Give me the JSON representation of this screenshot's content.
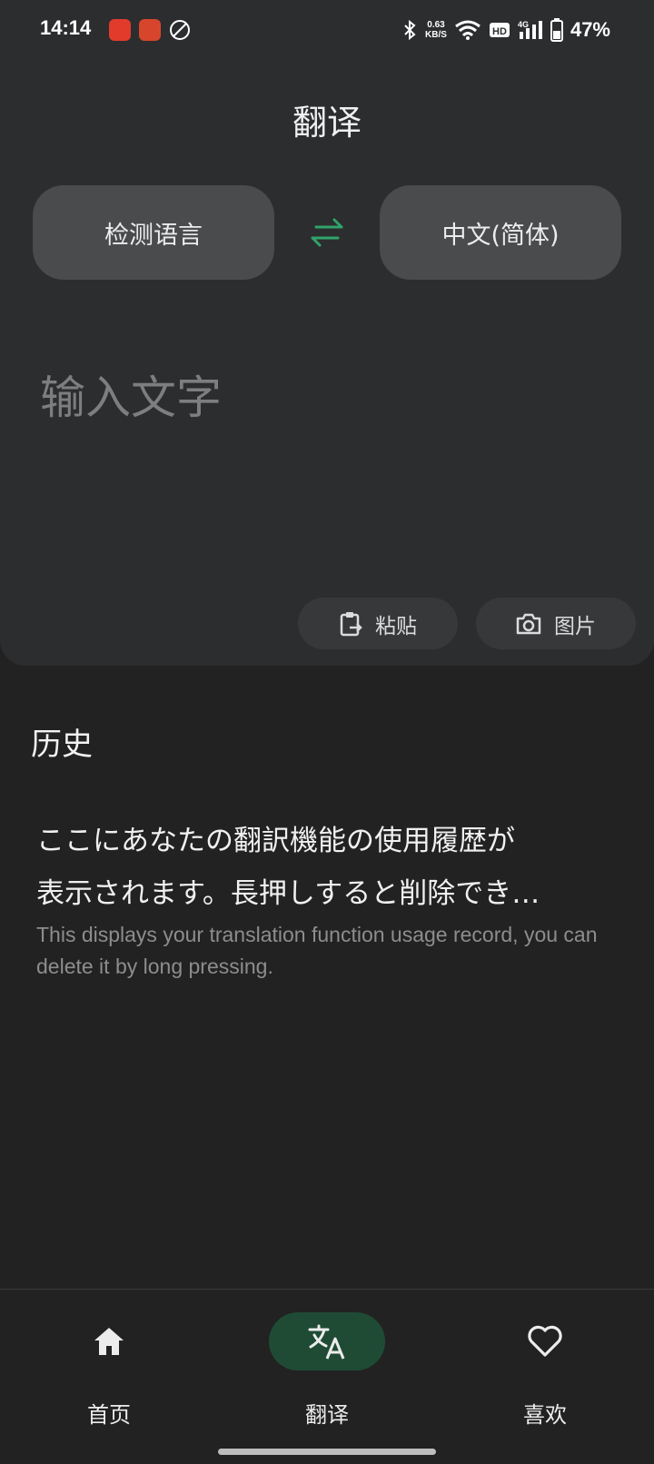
{
  "status_bar": {
    "time": "14:14",
    "net_speed_value": "0.63",
    "net_speed_unit": "KB/S",
    "battery": "47%"
  },
  "header": {
    "title": "翻译"
  },
  "languages": {
    "source": "检测语言",
    "target": "中文(简体)",
    "accent_color": "#2fa36b"
  },
  "input": {
    "placeholder": "输入文字"
  },
  "actions": {
    "paste_label": "粘贴",
    "image_label": "图片"
  },
  "history": {
    "title": "历史",
    "empty_text_line1": "ここにあなたの翻訳機能の使用履歴が",
    "empty_text_line2": "表示されます。長押しすると削除でき…",
    "empty_text_en": "This displays your translation function usage record, you can delete it by long pressing."
  },
  "bottom_nav": {
    "items": [
      {
        "label": "首页",
        "icon": "home-icon",
        "active": false
      },
      {
        "label": "翻译",
        "icon": "translate-icon",
        "active": true
      },
      {
        "label": "喜欢",
        "icon": "heart-icon",
        "active": false
      }
    ],
    "active_color": "#1f4b35"
  }
}
